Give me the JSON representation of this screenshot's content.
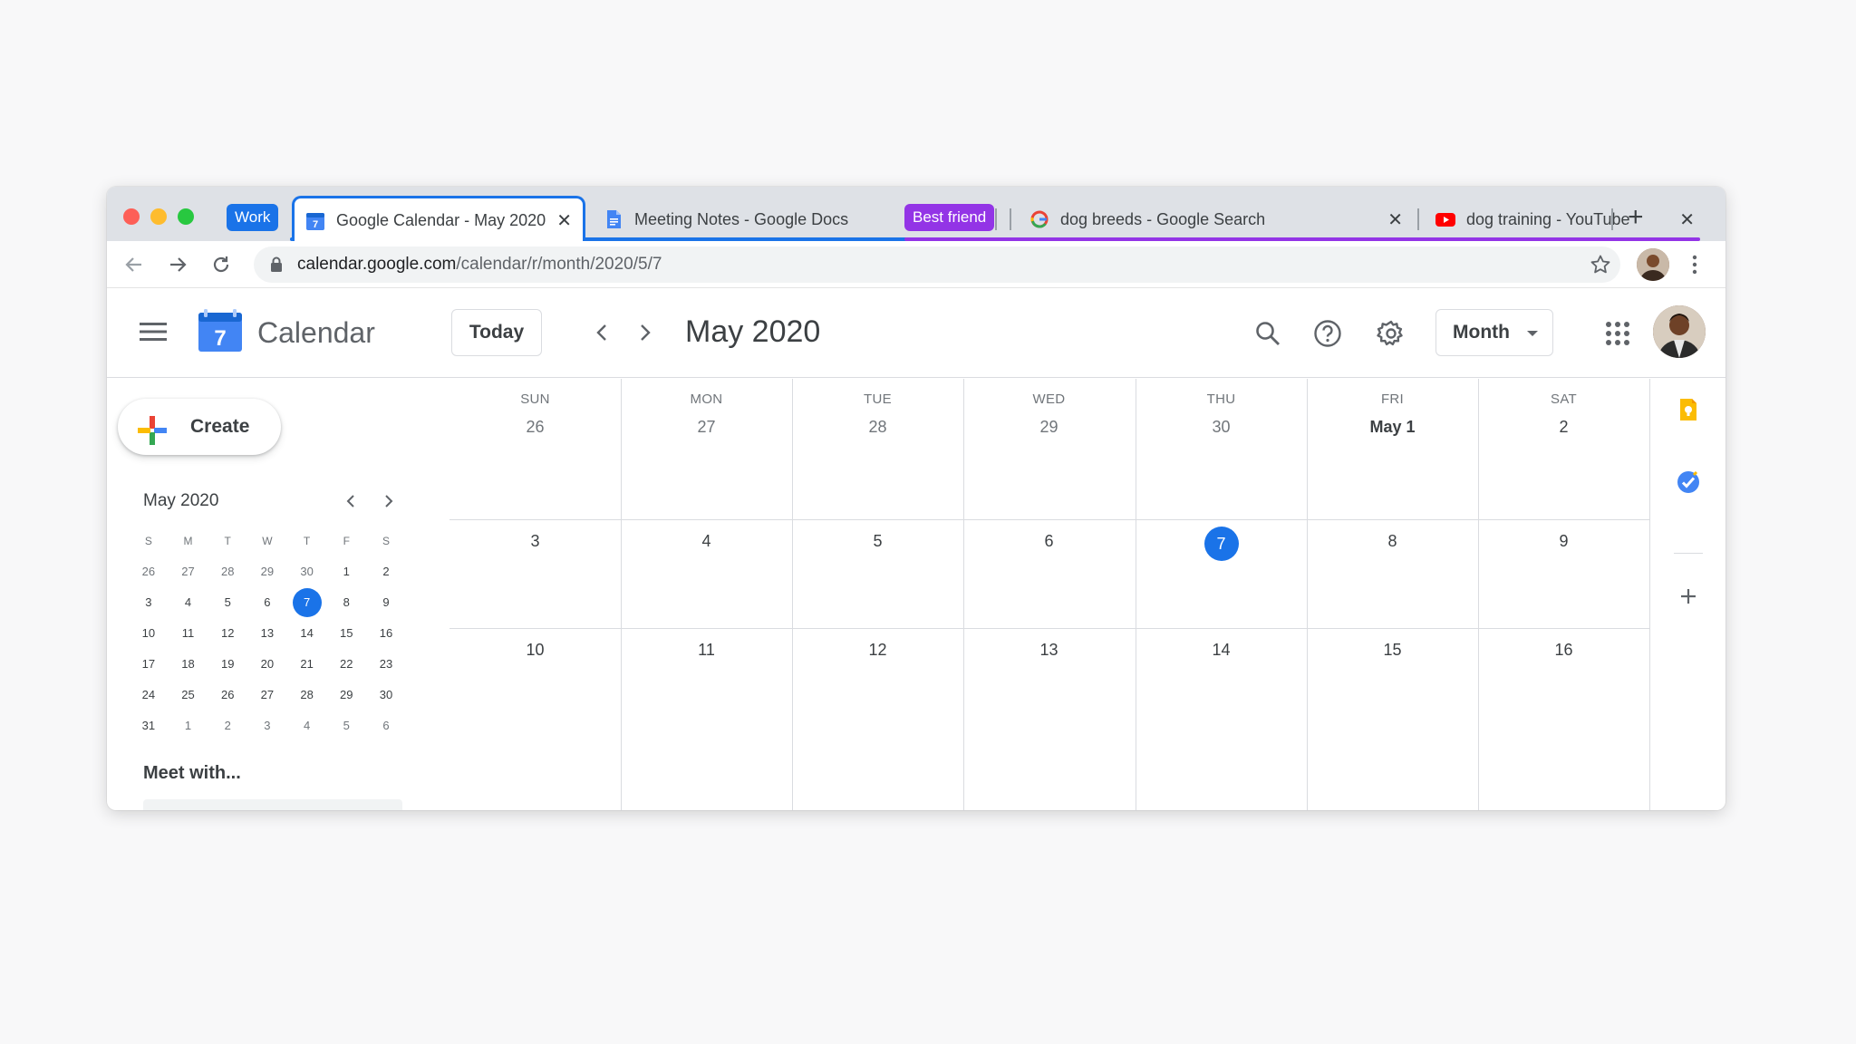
{
  "browser": {
    "groups": [
      {
        "label": "Work",
        "color": "#1a73e8"
      },
      {
        "label": "Best friend",
        "color": "#9334e6"
      }
    ],
    "tabs": [
      {
        "title": "Google Calendar - May 2020",
        "group": "Work",
        "active": true,
        "favicon": "calendar-favicon-icon"
      },
      {
        "title": "Meeting Notes - Google Docs",
        "group": "Work",
        "active": false,
        "favicon": "docs-favicon-icon"
      },
      {
        "title": "dog breeds - Google Search",
        "group": "Best friend",
        "active": false,
        "favicon": "google-favicon-icon"
      },
      {
        "title": "dog training - YouTube",
        "group": "Best friend",
        "active": false,
        "favicon": "youtube-favicon-icon"
      }
    ],
    "tab_close": "✕",
    "new_tab": "+",
    "address": {
      "host": "calendar.google.com",
      "path": "/calendar/r/month/2020/5/7"
    }
  },
  "header": {
    "app_name": "Calendar",
    "logo_number": "7",
    "today_label": "Today",
    "month_title": "May 2020",
    "view_label": "Month"
  },
  "sidebar": {
    "create_label": "Create",
    "mini_title": "May 2020",
    "weekday_initials": [
      "S",
      "M",
      "T",
      "W",
      "T",
      "F",
      "S"
    ],
    "weeks": [
      [
        "26",
        "27",
        "28",
        "29",
        "30",
        "1",
        "2"
      ],
      [
        "3",
        "4",
        "5",
        "6",
        "7",
        "8",
        "9"
      ],
      [
        "10",
        "11",
        "12",
        "13",
        "14",
        "15",
        "16"
      ],
      [
        "17",
        "18",
        "19",
        "20",
        "21",
        "22",
        "23"
      ],
      [
        "24",
        "25",
        "26",
        "27",
        "28",
        "29",
        "30"
      ],
      [
        "31",
        "1",
        "2",
        "3",
        "4",
        "5",
        "6"
      ]
    ],
    "today": "7",
    "meet_with": "Meet with..."
  },
  "month_grid": {
    "weekdays": [
      "SUN",
      "MON",
      "TUE",
      "WED",
      "THU",
      "FRI",
      "SAT"
    ],
    "weeks": [
      [
        "26",
        "27",
        "28",
        "29",
        "30",
        "May 1",
        "2"
      ],
      [
        "3",
        "4",
        "5",
        "6",
        "7",
        "8",
        "9"
      ],
      [
        "10",
        "11",
        "12",
        "13",
        "14",
        "15",
        "16"
      ]
    ],
    "today": "7"
  },
  "colors": {
    "accent": "#1a73e8",
    "work_group": "#1a73e8",
    "best_friend_group": "#9334e6",
    "keep": "#fbbc04",
    "tasks": "#4285f4"
  }
}
